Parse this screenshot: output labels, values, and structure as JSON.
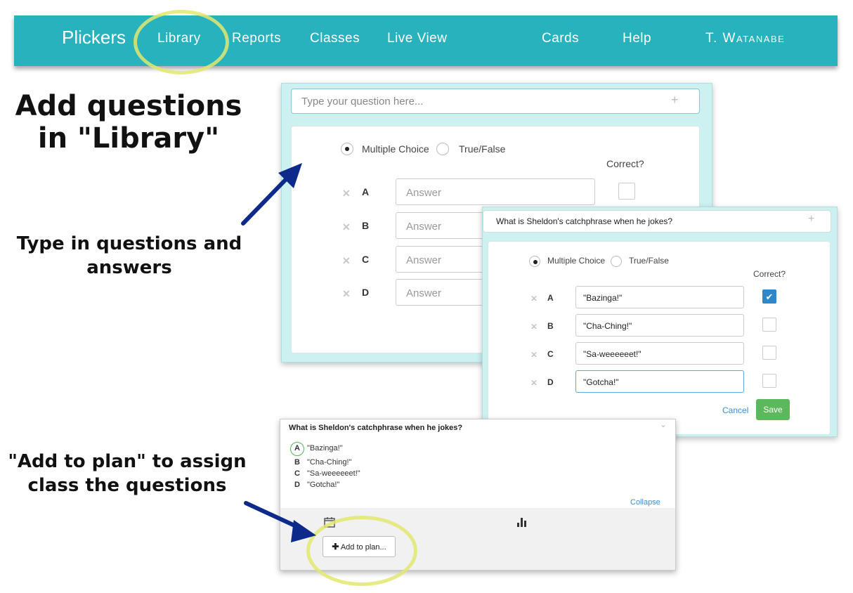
{
  "navbar": {
    "brand": "Plickers",
    "items": [
      "Library",
      "Reports",
      "Classes",
      "Live View",
      "Cards",
      "Help"
    ],
    "user": "T. Watanabe"
  },
  "annotations": {
    "heading": "Add questions in \"Library\"",
    "note_type": "Type in questions and answers",
    "note_plan": "\"Add to plan\" to assign class the questions"
  },
  "editor_empty": {
    "question_placeholder": "Type your question here...",
    "type_options": [
      "Multiple Choice",
      "True/False"
    ],
    "correct_label": "Correct?",
    "answers": [
      {
        "letter": "A",
        "placeholder": "Answer"
      },
      {
        "letter": "B",
        "placeholder": "Answer"
      },
      {
        "letter": "C",
        "placeholder": "Answer"
      },
      {
        "letter": "D",
        "placeholder": "Answer"
      }
    ]
  },
  "editor_filled": {
    "question": "What is Sheldon's catchphrase when he jokes?",
    "type_options": [
      "Multiple Choice",
      "True/False"
    ],
    "correct_label": "Correct?",
    "answers": [
      {
        "letter": "A",
        "value": "\"Bazinga!\"",
        "correct": true
      },
      {
        "letter": "B",
        "value": "\"Cha-Ching!\"",
        "correct": false
      },
      {
        "letter": "C",
        "value": "\"Sa-weeeeeet!\"",
        "correct": false
      },
      {
        "letter": "D",
        "value": "\"Gotcha!\"",
        "correct": false
      }
    ],
    "cancel_label": "Cancel",
    "save_label": "Save"
  },
  "question_card": {
    "question": "What is Sheldon's catchphrase when he jokes?",
    "answers": [
      {
        "letter": "A",
        "text": "\"Bazinga!\"",
        "correct": true
      },
      {
        "letter": "B",
        "text": "\"Cha-Ching!\"",
        "correct": false
      },
      {
        "letter": "C",
        "text": "\"Sa-weeeeeet!\"",
        "correct": false
      },
      {
        "letter": "D",
        "text": "\"Gotcha!\"",
        "correct": false
      }
    ],
    "collapse_label": "Collapse",
    "add_to_plan_label": "Add to plan..."
  },
  "colors": {
    "navbar": "#27b2bd",
    "panel": "#cdf1f1",
    "correct_check": "#2d87c8",
    "save_button": "#5cb85c",
    "link": "#3a8fd6",
    "highlight": "#e2e86e",
    "arrow": "#0d2a8a"
  },
  "icons": [
    "plus-icon",
    "x-icon",
    "check-icon",
    "chevron-down-icon",
    "bar-chart-icon",
    "calendar-icon",
    "arrow-icon"
  ]
}
